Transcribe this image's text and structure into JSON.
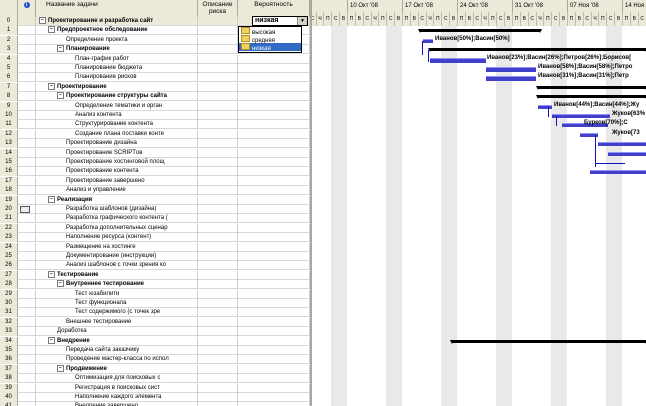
{
  "table": {
    "headers": {
      "info": "i",
      "name": "Название задачи",
      "risk": "Описание риска",
      "probability": "Вероятность"
    },
    "rows": [
      {
        "id": "0",
        "name": "Проектирование и разработка сайт",
        "level": 0,
        "summary": true
      },
      {
        "id": "1",
        "name": "Предпроектное обследование",
        "level": 1,
        "summary": true
      },
      {
        "id": "2",
        "name": "Определение проекта",
        "level": 3,
        "summary": false
      },
      {
        "id": "3",
        "name": "Планирование",
        "level": 2,
        "summary": true
      },
      {
        "id": "4",
        "name": "План-график работ",
        "level": 4,
        "summary": false
      },
      {
        "id": "5",
        "name": "Планирование бюджета",
        "level": 4,
        "summary": false
      },
      {
        "id": "6",
        "name": "Планирование рисков",
        "level": 4,
        "summary": false
      },
      {
        "id": "7",
        "name": "Проектирование",
        "level": 1,
        "summary": true
      },
      {
        "id": "8",
        "name": "Проектирование структуры сайта",
        "level": 2,
        "summary": true
      },
      {
        "id": "9",
        "name": "Определение тематики и орган",
        "level": 4,
        "summary": false
      },
      {
        "id": "10",
        "name": "Анализ контента",
        "level": 4,
        "summary": false
      },
      {
        "id": "11",
        "name": "Структурирование контента",
        "level": 4,
        "summary": false
      },
      {
        "id": "12",
        "name": "Создание плана поставки конте",
        "level": 4,
        "summary": false
      },
      {
        "id": "13",
        "name": "Проектирование дизайна",
        "level": 3,
        "summary": false
      },
      {
        "id": "14",
        "name": "Проектирование SCRIPTов",
        "level": 3,
        "summary": false
      },
      {
        "id": "15",
        "name": "Проектирование хостинговой площ",
        "level": 3,
        "summary": false
      },
      {
        "id": "16",
        "name": "Проектирование контента",
        "level": 3,
        "summary": false
      },
      {
        "id": "17",
        "name": "Проектирование завершено",
        "level": 3,
        "summary": false
      },
      {
        "id": "18",
        "name": "Анализ и управление",
        "level": 3,
        "summary": false
      },
      {
        "id": "19",
        "name": "Реализация",
        "level": 1,
        "summary": true
      },
      {
        "id": "20",
        "name": "Разработка шаблонов (дизайна)",
        "level": 3,
        "summary": false,
        "indicator": true
      },
      {
        "id": "21",
        "name": "Разработка графического контента (",
        "level": 3,
        "summary": false
      },
      {
        "id": "22",
        "name": "Разработка дополнительных сценар",
        "level": 3,
        "summary": false
      },
      {
        "id": "23",
        "name": "Наполнение ресурса (контент)",
        "level": 3,
        "summary": false
      },
      {
        "id": "24",
        "name": "Размещение на хостинге",
        "level": 3,
        "summary": false
      },
      {
        "id": "25",
        "name": "Документирование (инструкции)",
        "level": 3,
        "summary": false
      },
      {
        "id": "26",
        "name": "Анализ шаблонов с точки зрения ко",
        "level": 3,
        "summary": false
      },
      {
        "id": "27",
        "name": "Тестирование",
        "level": 1,
        "summary": true
      },
      {
        "id": "28",
        "name": "Внутреннее тестирование",
        "level": 2,
        "summary": true
      },
      {
        "id": "29",
        "name": "Тест юзабилити",
        "level": 4,
        "summary": false
      },
      {
        "id": "30",
        "name": "Тест функционала",
        "level": 4,
        "summary": false
      },
      {
        "id": "31",
        "name": "Тест содержимого (с точек зре",
        "level": 4,
        "summary": false
      },
      {
        "id": "32",
        "name": "Внешнее тестирование",
        "level": 3,
        "summary": false
      },
      {
        "id": "33",
        "name": "Доработка",
        "level": 2,
        "summary": false
      },
      {
        "id": "34",
        "name": "Внедрение",
        "level": 1,
        "summary": true
      },
      {
        "id": "35",
        "name": "Передача сайта заказчику",
        "level": 3,
        "summary": false
      },
      {
        "id": "36",
        "name": "Проведение мастер-класса по испол",
        "level": 3,
        "summary": false
      },
      {
        "id": "37",
        "name": "Продвижение",
        "level": 2,
        "summary": true
      },
      {
        "id": "38",
        "name": "Оптимизация для поисковых с",
        "level": 4,
        "summary": false
      },
      {
        "id": "39",
        "name": "Регистрация в поисковых сист",
        "level": 4,
        "summary": false
      },
      {
        "id": "40",
        "name": "Наполнение каждого элемента",
        "level": 4,
        "summary": false
      },
      {
        "id": "41",
        "name": "Внедрение завершено",
        "level": 4,
        "summary": false
      }
    ]
  },
  "probability_editor": {
    "current_value": "низкая",
    "options": [
      "высокая",
      "средняя",
      "низкая"
    ],
    "selected_option": "низкая"
  },
  "gantt": {
    "weeks": [
      {
        "label": "'08"
      },
      {
        "label": "10 Окт '08"
      },
      {
        "label": "17 Окт '08"
      },
      {
        "label": "24 Окт '08"
      },
      {
        "label": "31 Окт '08"
      },
      {
        "label": "07 Ноя '08"
      },
      {
        "label": "14 Ноя '0"
      }
    ],
    "day_letters": [
      "П",
      "В",
      "С",
      "Ч",
      "П",
      "С",
      "В"
    ],
    "bar_labels": [
      {
        "row": 2,
        "text": "Иванов[50%];Васин[50%]"
      },
      {
        "row": 4,
        "text": "Иванов[23%];Васин[26%];Петров[26%];Борисов["
      },
      {
        "row": 5,
        "text": "Иванов[58%];Васин[58%];Петро"
      },
      {
        "row": 6,
        "text": "Иванов[31%];Васин[31%];Петр"
      },
      {
        "row": 9,
        "text": "Иванов[44%];Васин[44%];Жу"
      },
      {
        "row": 10,
        "text": "Жуков[63%"
      },
      {
        "row": 11,
        "text": "Бурков[70%];С"
      },
      {
        "row": 12,
        "text": "Жуков[73"
      }
    ]
  }
}
